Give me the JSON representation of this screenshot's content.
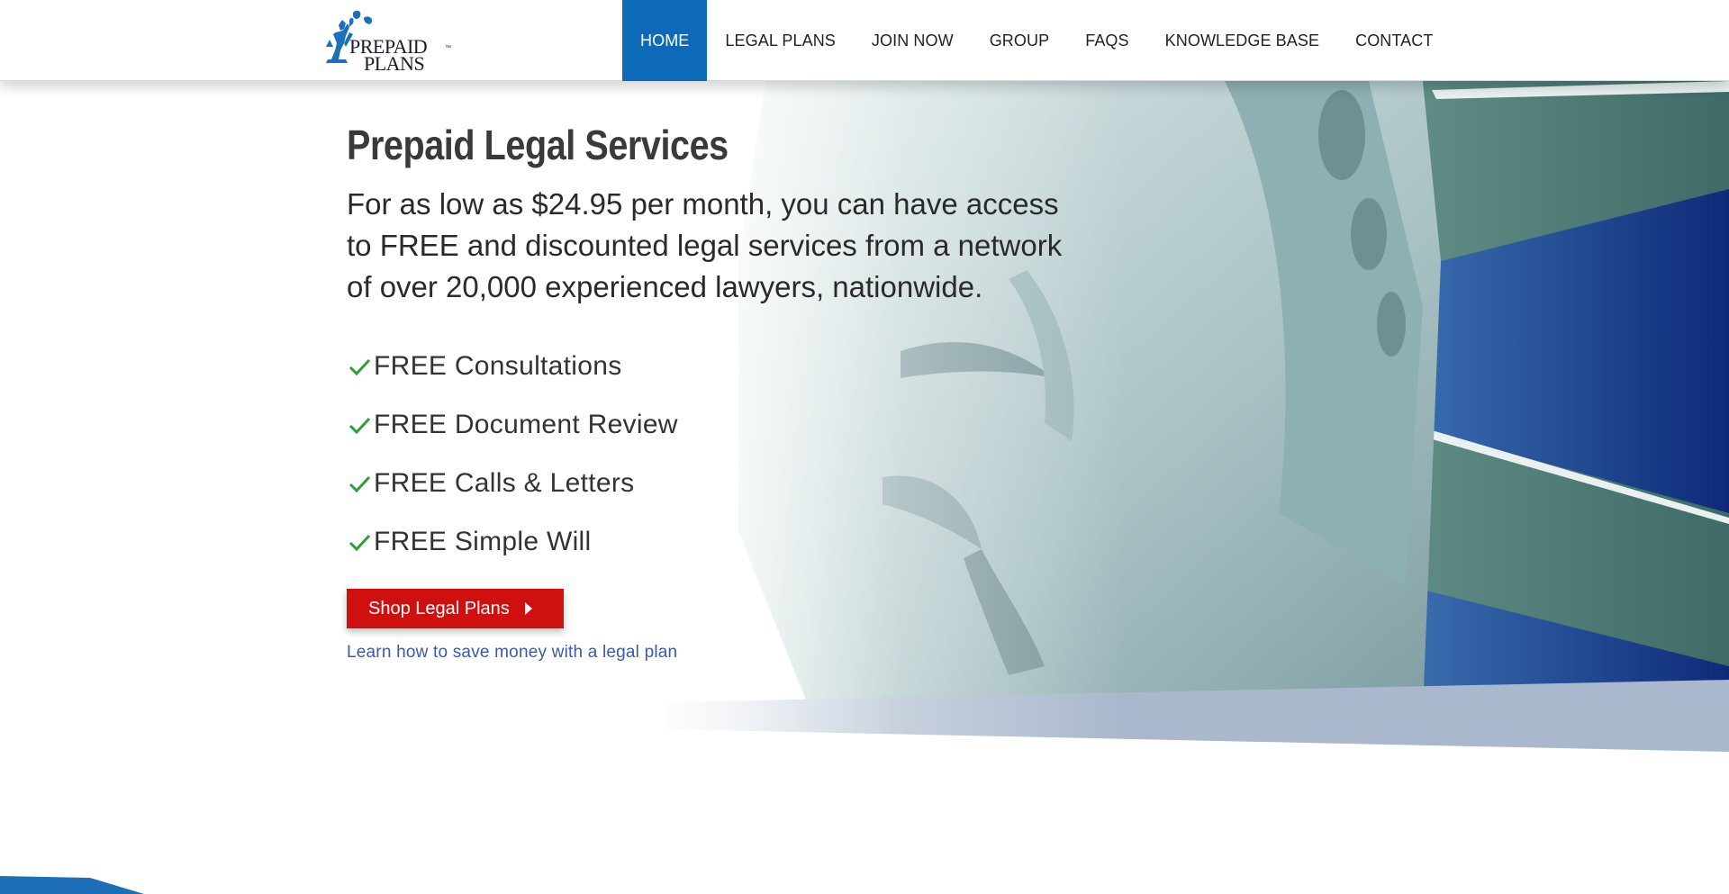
{
  "colors": {
    "nav_active_bg": "#0d6ab8",
    "cta_bg": "#d00f0f",
    "link": "#3a5aa8",
    "check": "#2e9e3a"
  },
  "logo": {
    "line1": "PREPAID",
    "line2": "PLANS",
    "tm": "™"
  },
  "nav": {
    "items": [
      {
        "label": "HOME",
        "active": true
      },
      {
        "label": "LEGAL PLANS"
      },
      {
        "label": "JOIN NOW"
      },
      {
        "label": "GROUP"
      },
      {
        "label": "FAQS"
      },
      {
        "label": "KNOWLEDGE BASE"
      },
      {
        "label": "CONTACT"
      }
    ]
  },
  "hero": {
    "title": "Prepaid Legal Services",
    "subtitle": "For as low as $24.95 per month, you can have access to FREE and discounted legal services from a network of over 20,000 experienced lawyers, nationwide.",
    "features": [
      "FREE Consultations",
      "FREE Document Review",
      "FREE Calls & Letters",
      "FREE Simple Will"
    ],
    "feature_icon": "checkmark-icon",
    "cta_label": "Shop Legal Plans",
    "cta_icon": "caret-right-icon",
    "learn_link": "Learn how to save money with a legal plan"
  }
}
